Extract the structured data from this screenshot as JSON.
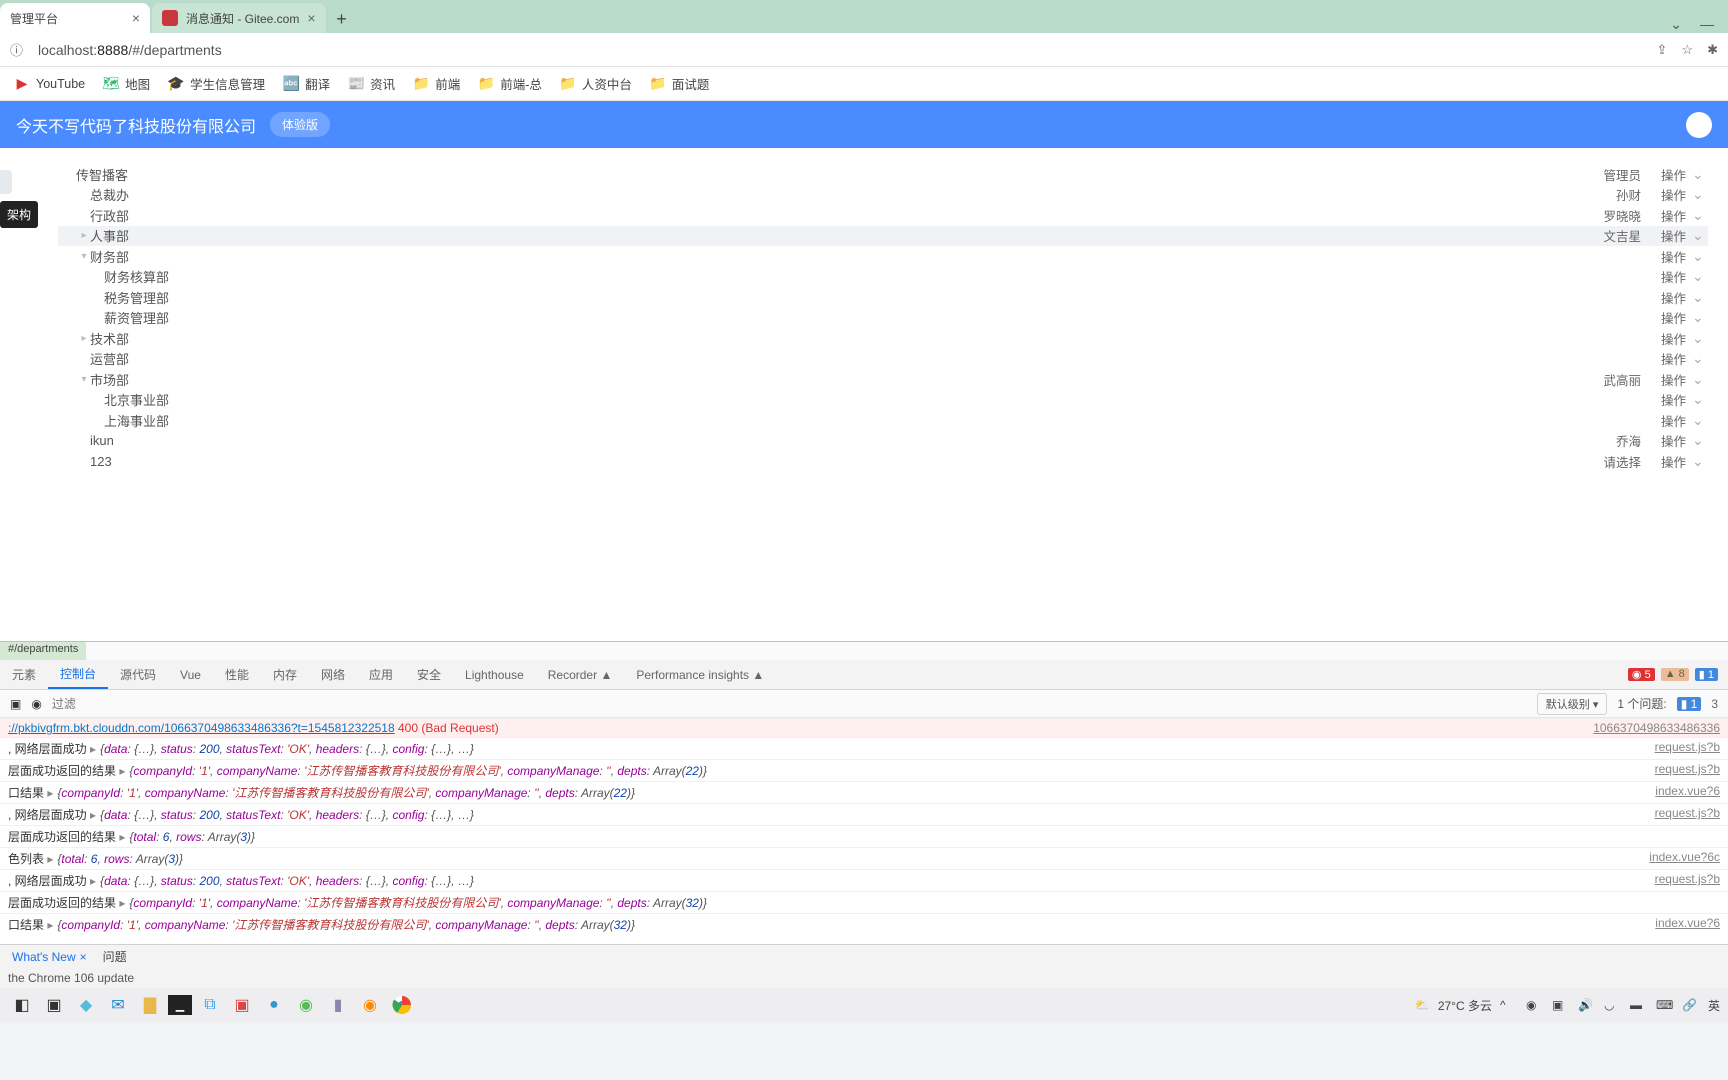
{
  "browser": {
    "tabs": [
      {
        "title": "管理平台",
        "active": true
      },
      {
        "title": "消息通知 - Gitee.com",
        "active": false
      }
    ],
    "url_prefix": "localhost:",
    "url_port": "8888",
    "url_path": "/#/departments",
    "info_icon": "ⓘ"
  },
  "bookmarks": [
    {
      "icon": "yt",
      "label": "YouTube"
    },
    {
      "icon": "map",
      "label": "地图"
    },
    {
      "icon": "hat",
      "label": "学生信息管理"
    },
    {
      "icon": "trans",
      "label": "翻译"
    },
    {
      "icon": "news",
      "label": "资讯"
    },
    {
      "icon": "folder",
      "label": "前端"
    },
    {
      "icon": "folder",
      "label": "前端-总"
    },
    {
      "icon": "folder",
      "label": "人资中台"
    },
    {
      "icon": "folder",
      "label": "面试题"
    }
  ],
  "app": {
    "title": "今天不写代码了科技股份有限公司",
    "badge": "体验版",
    "side_btn": "架构"
  },
  "tree": [
    {
      "indent": 0,
      "expand": "",
      "label": "传智播客",
      "owner": "管理员",
      "action": "操作"
    },
    {
      "indent": 1,
      "expand": "",
      "label": "总裁办",
      "owner": "孙财",
      "action": "操作"
    },
    {
      "indent": 1,
      "expand": "",
      "label": "行政部",
      "owner": "罗晓晓",
      "action": "操作"
    },
    {
      "indent": 1,
      "expand": "▸",
      "label": "人事部",
      "owner": "文吉星",
      "action": "操作",
      "selected": true
    },
    {
      "indent": 1,
      "expand": "▾",
      "label": "财务部",
      "owner": "",
      "action": "操作"
    },
    {
      "indent": 2,
      "expand": "",
      "label": "财务核算部",
      "owner": "",
      "action": "操作"
    },
    {
      "indent": 2,
      "expand": "",
      "label": "税务管理部",
      "owner": "",
      "action": "操作"
    },
    {
      "indent": 2,
      "expand": "",
      "label": "薪资管理部",
      "owner": "",
      "action": "操作"
    },
    {
      "indent": 1,
      "expand": "▸",
      "label": "技术部",
      "owner": "",
      "action": "操作"
    },
    {
      "indent": 1,
      "expand": "",
      "label": "运营部",
      "owner": "",
      "action": "操作"
    },
    {
      "indent": 1,
      "expand": "▾",
      "label": "市场部",
      "owner": "武高丽",
      "action": "操作"
    },
    {
      "indent": 2,
      "expand": "",
      "label": "北京事业部",
      "owner": "",
      "action": "操作"
    },
    {
      "indent": 2,
      "expand": "",
      "label": "上海事业部",
      "owner": "",
      "action": "操作"
    },
    {
      "indent": 1,
      "expand": "",
      "label": "ikun",
      "owner": "乔海",
      "action": "操作"
    },
    {
      "indent": 1,
      "expand": "",
      "label": "123",
      "owner": "请选择",
      "action": "操作"
    }
  ],
  "devtools": {
    "file_tab": "#/departments",
    "tabs": [
      "元素",
      "控制台",
      "源代码",
      "Vue",
      "性能",
      "内存",
      "网络",
      "应用",
      "安全",
      "Lighthouse",
      "Recorder ▲",
      "Performance insights ▲"
    ],
    "active_tab": "控制台",
    "filter_placeholder": "过滤",
    "level_label": "默认级别 ▾",
    "issue_label": "1 个问题:",
    "issue_count": "1",
    "err_count": "5",
    "warn_count": "8",
    "info_count": "1",
    "trailing_num": "3",
    "logs": [
      {
        "type": "error",
        "url": "://pkbivgfrm.bkt.clouddn.com/1066370498633486336?t=1545812322518",
        "status": "400 (Bad Request)",
        "src": "1066370498633486336"
      },
      {
        "type": "obj",
        "prefix": ", 网络层面成功",
        "props": "{data: {…}, status: 200, statusText: 'OK', headers: {…}, config: {…}, …}",
        "src": "request.js?b"
      },
      {
        "type": "obj",
        "prefix": "层面成功返回的结果",
        "props": "{companyId: '1', companyName: '江苏传智播客教育科技股份有限公司', companyManage: '', depts: Array(22)}",
        "src": "request.js?b"
      },
      {
        "type": "obj",
        "prefix": "口结果",
        "props": "{companyId: '1', companyName: '江苏传智播客教育科技股份有限公司', companyManage: '', depts: Array(22)}",
        "src": "index.vue?6"
      },
      {
        "type": "obj",
        "prefix": ", 网络层面成功",
        "props": "{data: {…}, status: 200, statusText: 'OK', headers: {…}, config: {…}, …}",
        "src": "request.js?b"
      },
      {
        "type": "obj",
        "prefix": "层面成功返回的结果",
        "props": "{total: 6, rows: Array(3)}",
        "src": ""
      },
      {
        "type": "obj",
        "prefix": "色列表",
        "props": "{total: 6, rows: Array(3)}",
        "src": "index.vue?6c"
      },
      {
        "type": "obj",
        "prefix": ", 网络层面成功",
        "props": "{data: {…}, status: 200, statusText: 'OK', headers: {…}, config: {…}, …}",
        "src": "request.js?b"
      },
      {
        "type": "obj",
        "prefix": "层面成功返回的结果",
        "props": "{companyId: '1', companyName: '江苏传智播客教育科技股份有限公司', companyManage: '', depts: Array(32)}",
        "src": ""
      },
      {
        "type": "obj",
        "prefix": "口结果",
        "props": "{companyId: '1', companyName: '江苏传智播客教育科技股份有限公司', companyManage: '', depts: Array(32)}",
        "src": "index.vue?6"
      }
    ]
  },
  "drawer": {
    "tabs": [
      "What's New",
      "问题"
    ],
    "body": "the Chrome 106 update"
  },
  "taskbar": {
    "weather": "27°C 多云",
    "ime": "英"
  }
}
